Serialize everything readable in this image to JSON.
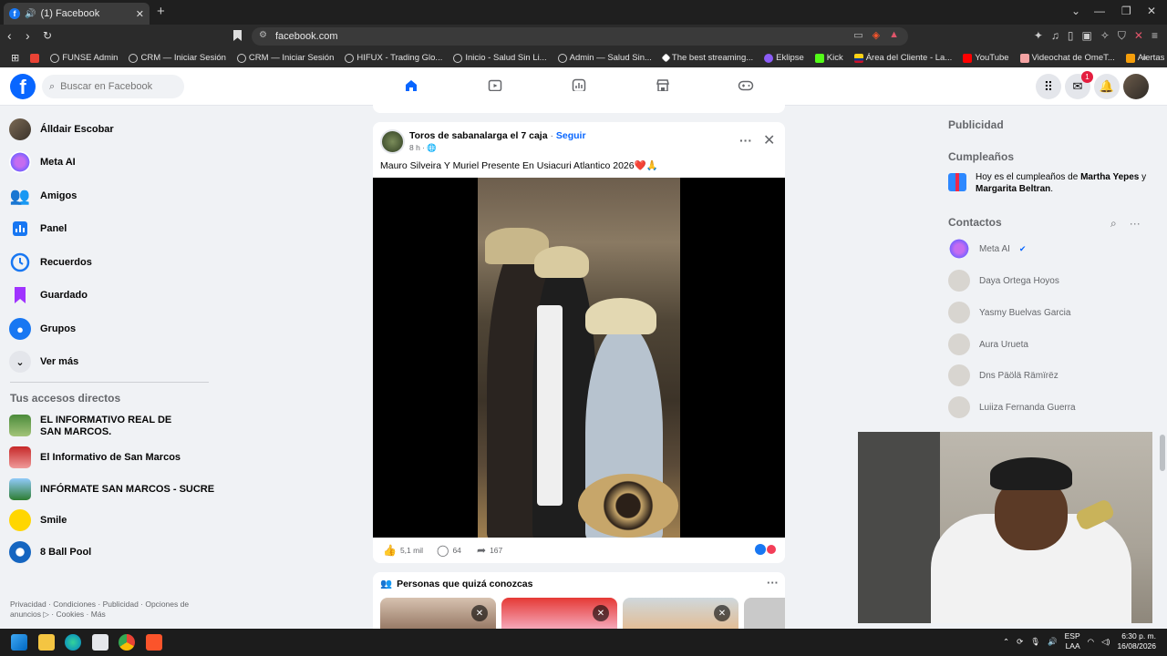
{
  "browser": {
    "tab_title": "(1) Facebook",
    "url": "facebook.com",
    "bookmarks": [
      {
        "label": "",
        "icon": "gmail-icon"
      },
      {
        "label": "FUNSE Admin",
        "icon": "globe-icon"
      },
      {
        "label": "CRM — Iniciar Sesión",
        "icon": "globe-icon"
      },
      {
        "label": "CRM — Iniciar Sesión",
        "icon": "globe-icon"
      },
      {
        "label": "HIFUX - Trading Glo...",
        "icon": "globe-icon"
      },
      {
        "label": "Inicio - Salud Sin Li...",
        "icon": "globe-icon"
      },
      {
        "label": "Admin — Salud Sin...",
        "icon": "globe-icon"
      },
      {
        "label": "The best streaming...",
        "icon": "globe-icon"
      },
      {
        "label": "Eklipse",
        "icon": "eklipse-icon"
      },
      {
        "label": "Kick",
        "icon": "kick-icon"
      },
      {
        "label": "Área del Cliente - La...",
        "icon": "flag-icon"
      },
      {
        "label": "YouTube",
        "icon": "youtube-icon"
      },
      {
        "label": "Videochat de OmeT...",
        "icon": "omegle-icon"
      },
      {
        "label": "Alertas animadas de...",
        "icon": "alert-icon"
      }
    ]
  },
  "header": {
    "search_placeholder": "Buscar en Facebook",
    "messenger_badge": "1"
  },
  "sidebar": {
    "items": [
      {
        "label": "Álldair Escobar",
        "icon": "profile-avatar"
      },
      {
        "label": "Meta AI",
        "icon": "meta-ai-icon"
      },
      {
        "label": "Amigos",
        "icon": "friends-icon"
      },
      {
        "label": "Panel",
        "icon": "dashboard-icon"
      },
      {
        "label": "Recuerdos",
        "icon": "clock-icon"
      },
      {
        "label": "Guardado",
        "icon": "bookmark-icon"
      },
      {
        "label": "Grupos",
        "icon": "groups-icon"
      },
      {
        "label": "Ver más",
        "icon": "chevron-down-icon"
      }
    ],
    "shortcuts_title": "Tus accesos directos",
    "shortcuts": [
      {
        "label": "EL INFORMATIVO REAL DE SAN MARCOS."
      },
      {
        "label": "El Informativo de San Marcos"
      },
      {
        "label": "INFÓRMATE SAN MARCOS - SUCRE"
      },
      {
        "label": "Smile"
      },
      {
        "label": "8 Ball Pool"
      }
    ],
    "footer": "Privacidad · Condiciones · Publicidad · Opciones de anuncios ▷ · Cookies · Más"
  },
  "post": {
    "author": "Toros de sabanalarga el 7 caja",
    "follow": "Seguir",
    "time": "8 h ·",
    "text": "Mauro Silveira Y Muriel Presente En Usiacuri Atlantico 2026❤️🙏",
    "likes": "5,1 mil",
    "comments": "64",
    "shares": "167"
  },
  "pymk": {
    "title": "Personas que quizá conozcas"
  },
  "right": {
    "ads_title": "Publicidad",
    "birthdays_title": "Cumpleaños",
    "birthday_prefix": "Hoy es el cumpleaños de ",
    "birthday_name1": "Martha Yepes",
    "birthday_mid": " y ",
    "birthday_name2": "Margarita Beltran",
    "birthday_suffix": ".",
    "contacts_title": "Contactos",
    "contacts": [
      {
        "name": "Meta AI"
      },
      {
        "name": "Daya Ortega Hoyos"
      },
      {
        "name": "Yasmy Buelvas Garcia"
      },
      {
        "name": "Aura Urueta"
      },
      {
        "name": "Dns Päölä Rämïrëz"
      },
      {
        "name": "Luiiza Fernanda Guerra"
      }
    ]
  },
  "taskbar": {
    "lang1": "ESP",
    "lang2": "LAA",
    "time": "6:30 p. m.",
    "date": "16/08/2026"
  },
  "colors": {
    "facebook_blue": "#0866ff",
    "background": "#f0f2f5"
  }
}
